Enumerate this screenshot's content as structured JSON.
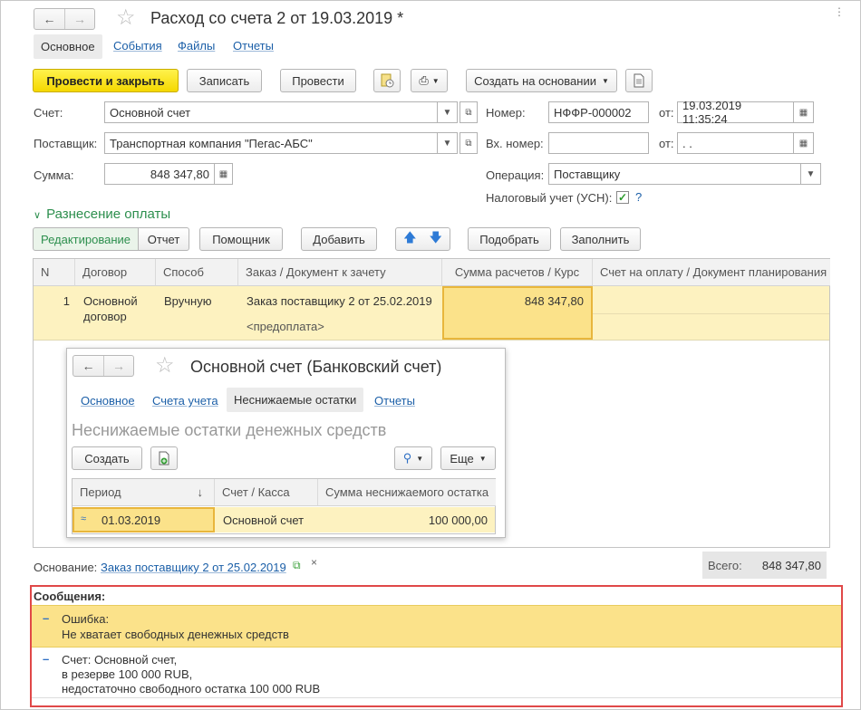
{
  "window": {
    "title": "Расход со счета 2 от 19.03.2019 *",
    "tabs": [
      "Основное",
      "События",
      "Файлы",
      "Отчеты"
    ]
  },
  "toolbar": {
    "post_close": "Провести и закрыть",
    "save": "Записать",
    "post": "Провести",
    "create_based": "Создать на основании"
  },
  "form": {
    "account_label": "Счет:",
    "account_value": "Основной счет",
    "supplier_label": "Поставщик:",
    "supplier_value": "Транспортная компания \"Пегас-АБС\"",
    "sum_label": "Сумма:",
    "sum_value": "848 347,80",
    "number_label": "Номер:",
    "number_value": "НФФР-000002",
    "from_label": "от:",
    "date_value": "19.03.2019 11:35:24",
    "in_number_label": "Вх. номер:",
    "in_number_value": "",
    "from_label2": "от:",
    "in_date_value": " .  .",
    "operation_label": "Операция:",
    "operation_value": "Поставщику",
    "tax_label": "Налоговый учет (УСН):",
    "tax_checked": true,
    "help": "?"
  },
  "section": {
    "title": "Разнесение оплаты",
    "mode_edit": "Редактирование",
    "mode_report": "Отчет",
    "helper": "Помощник",
    "add": "Добавить",
    "pick": "Подобрать",
    "fill": "Заполнить"
  },
  "table": {
    "headers": [
      "N",
      "Договор",
      "Способ",
      "Заказ / Документ к зачету",
      "Сумма расчетов / Курс",
      "Счет на оплату / Документ планирования"
    ],
    "row": {
      "n": "1",
      "contract_line1": "Основной",
      "contract_line2": "договор",
      "method": "Вручную",
      "order": "Заказ поставщику 2 от 25.02.2019",
      "order_sub": "<предоплата>",
      "sum": "848 347,80",
      "invoice": ""
    }
  },
  "popup": {
    "title": "Основной счет (Банковский счет)",
    "tabs": [
      "Основное",
      "Счета учета",
      "Неснижаемые остатки",
      "Отчеты"
    ],
    "heading": "Неснижаемые остатки денежных средств",
    "create": "Создать",
    "more": "Еще",
    "headers": [
      "Период",
      "Счет / Касса",
      "Сумма неснижаемого остатка"
    ],
    "sort_arrow": "↓",
    "row": {
      "period": "01.03.2019",
      "account": "Основной счет",
      "amount": "100 000,00"
    }
  },
  "footer": {
    "basis_label": "Основание:",
    "basis_link": "Заказ поставщику 2 от 25.02.2019",
    "total_label": "Всего:",
    "total_value": "848 347,80"
  },
  "messages": {
    "title": "Сообщения:",
    "items": [
      {
        "line1": "Ошибка:",
        "line2": "Не хватает свободных денежных средств",
        "line3": ""
      },
      {
        "line1": "Счет: Основной счет,",
        "line2": "в резерве 100 000 RUB,",
        "line3": "недостаточно свободного остатка 100 000 RUB"
      }
    ]
  },
  "colors": {
    "accent_yellow": "#f5d800",
    "row_highlight": "#fdf2c0",
    "link_blue": "#1b5fa8",
    "section_green": "#2d8f4e",
    "error_border": "#e04848"
  }
}
